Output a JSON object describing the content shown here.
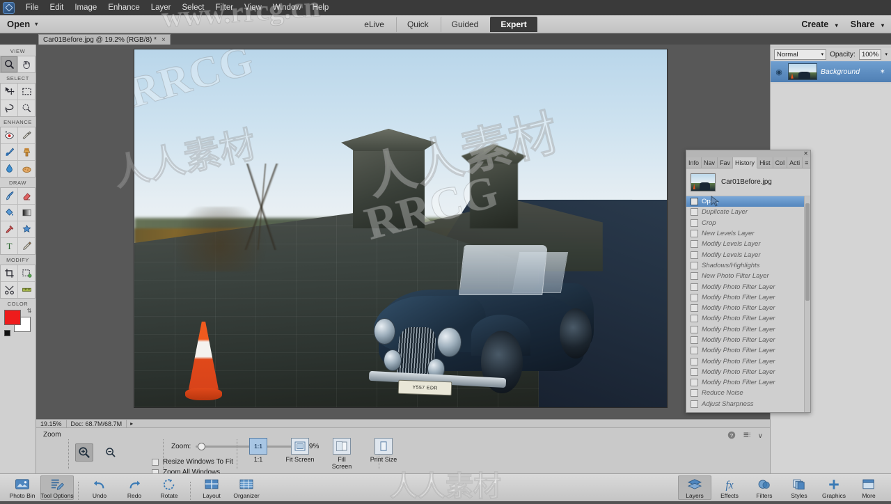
{
  "menubar": {
    "logo_icon": "photoshop-elements-logo",
    "items": [
      "File",
      "Edit",
      "Image",
      "Enhance",
      "Layer",
      "Select",
      "Filter",
      "View",
      "Window",
      "Help"
    ]
  },
  "topbar": {
    "open_label": "Open",
    "open_caret": "▾",
    "modes": [
      {
        "label": "eLive",
        "active": false
      },
      {
        "label": "Quick",
        "active": false
      },
      {
        "label": "Guided",
        "active": false
      },
      {
        "label": "Expert",
        "active": true
      }
    ],
    "create_label": "Create",
    "share_label": "Share",
    "caret": "▾"
  },
  "document_tab": {
    "title": "Car01Before.jpg @ 19.2% (RGB/8) *",
    "close_icon": "×"
  },
  "toolbox": {
    "sections": [
      {
        "label": "VIEW",
        "tools": [
          {
            "name": "zoom-tool",
            "active": true
          },
          {
            "name": "hand-tool",
            "active": false
          }
        ]
      },
      {
        "label": "SELECT",
        "tools": [
          {
            "name": "move-tool",
            "active": false
          },
          {
            "name": "rectangular-marquee-tool",
            "active": false
          },
          {
            "name": "lasso-tool",
            "active": false
          },
          {
            "name": "quick-selection-tool",
            "active": false
          }
        ]
      },
      {
        "label": "ENHANCE",
        "tools": [
          {
            "name": "red-eye-removal-tool",
            "active": false
          },
          {
            "name": "spot-healing-brush-tool",
            "active": false
          },
          {
            "name": "smart-brush-tool",
            "active": false
          },
          {
            "name": "clone-stamp-tool",
            "active": false
          },
          {
            "name": "blur-tool",
            "active": false
          },
          {
            "name": "sponge-tool",
            "active": false
          }
        ]
      },
      {
        "label": "DRAW",
        "tools": [
          {
            "name": "brush-tool",
            "active": false
          },
          {
            "name": "eraser-tool",
            "active": false
          },
          {
            "name": "paint-bucket-tool",
            "active": false
          },
          {
            "name": "gradient-tool",
            "active": false
          },
          {
            "name": "eyedropper-tool",
            "active": false
          },
          {
            "name": "cookie-cutter-tool",
            "active": false
          },
          {
            "name": "type-tool",
            "active": false
          },
          {
            "name": "pencil-tool",
            "active": false
          }
        ]
      },
      {
        "label": "MODIFY",
        "tools": [
          {
            "name": "crop-tool",
            "active": false
          },
          {
            "name": "recompose-tool",
            "active": false
          },
          {
            "name": "content-aware-move-tool",
            "active": false
          },
          {
            "name": "straighten-tool",
            "active": false
          }
        ]
      }
    ],
    "color_label": "COLOR",
    "foreground_color": "#ee1c1c",
    "background_color": "#ffffff"
  },
  "canvas": {
    "image_name": "Car01Before.jpg",
    "license_plate": "Y557 EDR",
    "watermarks": [
      "RRCG",
      "人人素材",
      "RRCG"
    ]
  },
  "statusbar": {
    "zoom_percent": "19.15%",
    "doc_size": "Doc: 68.7M/68.7M",
    "arrow_icon": "▸"
  },
  "tool_options": {
    "title": "Zoom",
    "zoom_in_icon": "zoom-in-icon",
    "zoom_out_icon": "zoom-out-icon",
    "zoom_label": "Zoom:",
    "zoom_value": "19%",
    "checkbox_resize": "Resize Windows To Fit",
    "checkbox_zoom_all": "Zoom All Windows",
    "presets": [
      {
        "label": "1:1",
        "icon_text": "1:1",
        "selected": true
      },
      {
        "label": "Fit Screen",
        "icon_text": "",
        "selected": false
      },
      {
        "label": "Fill Screen",
        "icon_text": "",
        "selected": false
      },
      {
        "label": "Print Size",
        "icon_text": "",
        "selected": false
      }
    ],
    "help_icon": "help-icon",
    "menu_icon": "panel-menu-icon",
    "collapse_icon": "∨"
  },
  "layers_panel": {
    "toolbar_icons": [
      "add-layer-icon",
      "duplicate-layer-icon",
      "adjustment-layer-icon",
      "layer-mask-icon",
      "lock-layer-icon",
      "group-layers-icon",
      "delete-layer-icon",
      "panel-menu-icon"
    ],
    "blend_mode": "Normal",
    "blend_caret": "▾",
    "opacity_label": "Opacity:",
    "opacity_value": "100%",
    "opacity_caret": "▾",
    "layers": [
      {
        "name": "Background",
        "visible": true,
        "locked": true,
        "selected": true
      }
    ],
    "eye_icon": "◉",
    "lock_icon": "✶"
  },
  "history_panel": {
    "close_icon": "✕",
    "tabs": [
      {
        "label": "Info",
        "short": "Info",
        "active": false
      },
      {
        "label": "Navigator",
        "short": "Nav",
        "active": false
      },
      {
        "label": "Favorites",
        "short": "Fav",
        "active": false
      },
      {
        "label": "History",
        "short": "History",
        "active": true
      },
      {
        "label": "Histogram",
        "short": "Hist",
        "active": false
      },
      {
        "label": "Color Swatches",
        "short": "Col",
        "active": false
      },
      {
        "label": "Actions",
        "short": "Acti",
        "active": false
      }
    ],
    "menu_icon": "≡",
    "source_name": "Car01Before.jpg",
    "items": [
      {
        "label": "Open",
        "selected": true
      },
      {
        "label": "Duplicate Layer",
        "selected": false
      },
      {
        "label": "Crop",
        "selected": false
      },
      {
        "label": "New Levels Layer",
        "selected": false
      },
      {
        "label": "Modify Levels Layer",
        "selected": false
      },
      {
        "label": "Modify Levels Layer",
        "selected": false
      },
      {
        "label": "Shadows/Highlights",
        "selected": false
      },
      {
        "label": "New Photo Filter Layer",
        "selected": false
      },
      {
        "label": "Modify Photo Filter Layer",
        "selected": false
      },
      {
        "label": "Modify Photo Filter Layer",
        "selected": false
      },
      {
        "label": "Modify Photo Filter Layer",
        "selected": false
      },
      {
        "label": "Modify Photo Filter Layer",
        "selected": false
      },
      {
        "label": "Modify Photo Filter Layer",
        "selected": false
      },
      {
        "label": "Modify Photo Filter Layer",
        "selected": false
      },
      {
        "label": "Modify Photo Filter Layer",
        "selected": false
      },
      {
        "label": "Modify Photo Filter Layer",
        "selected": false
      },
      {
        "label": "Modify Photo Filter Layer",
        "selected": false
      },
      {
        "label": "Modify Photo Filter Layer",
        "selected": false
      },
      {
        "label": "Reduce Noise",
        "selected": false
      },
      {
        "label": "Adjust Sharpness",
        "selected": false
      }
    ]
  },
  "taskbar": {
    "left_items": [
      {
        "label": "Photo Bin",
        "icon": "photo-bin-icon",
        "active": false
      },
      {
        "label": "Tool Options",
        "icon": "tool-options-icon",
        "active": true
      },
      {
        "label": "Undo",
        "icon": "undo-icon",
        "active": false
      },
      {
        "label": "Redo",
        "icon": "redo-icon",
        "active": false
      },
      {
        "label": "Rotate",
        "icon": "rotate-icon",
        "active": false
      },
      {
        "label": "Layout",
        "icon": "layout-icon",
        "active": false
      },
      {
        "label": "Organizer",
        "icon": "organizer-icon",
        "active": false
      }
    ],
    "right_items": [
      {
        "label": "Layers",
        "icon": "layers-icon",
        "active": true
      },
      {
        "label": "Effects",
        "icon": "effects-fx-icon",
        "active": false
      },
      {
        "label": "Filters",
        "icon": "filters-icon",
        "active": false
      },
      {
        "label": "Styles",
        "icon": "styles-icon",
        "active": false
      },
      {
        "label": "Graphics",
        "icon": "graphics-plus-icon",
        "active": false
      },
      {
        "label": "More",
        "icon": "more-icon",
        "active": false
      }
    ]
  },
  "watermarks": {
    "top": "www.rrcg.cn",
    "center_left": "人人素材",
    "bottom": "人人素材"
  }
}
